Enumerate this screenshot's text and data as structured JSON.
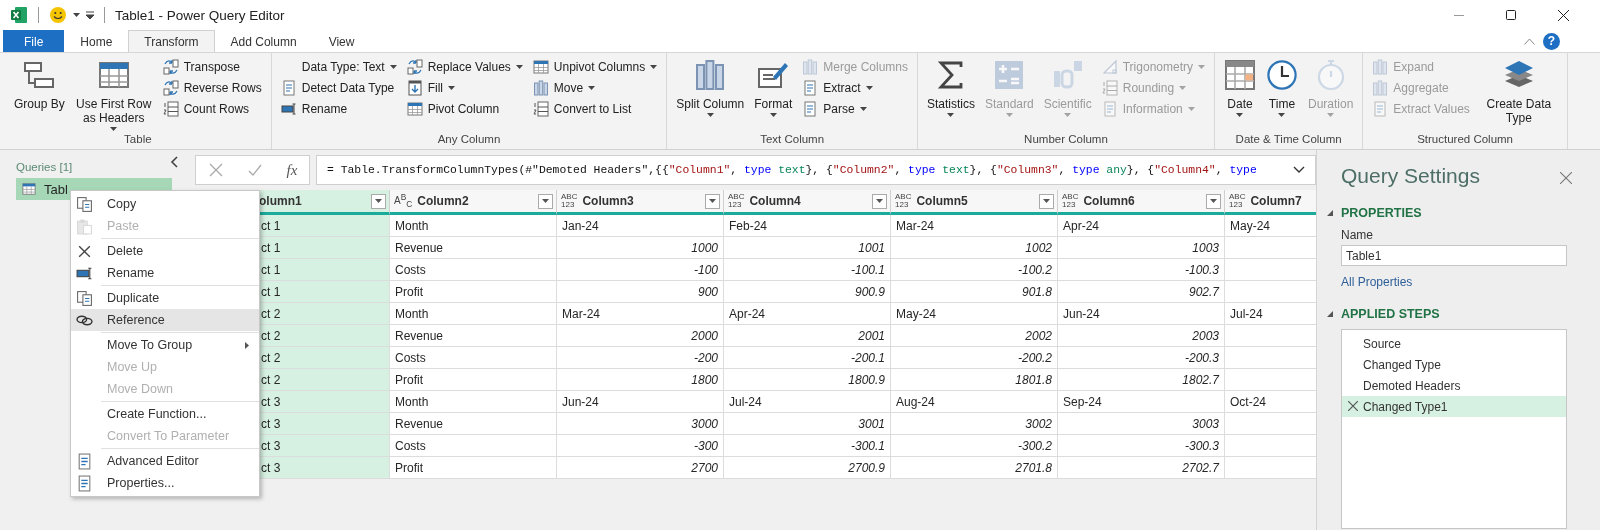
{
  "window": {
    "title": "Table1 - Power Query Editor"
  },
  "tabs": [
    {
      "label": "File",
      "kind": "file",
      "selected": false
    },
    {
      "label": "Home",
      "kind": "tab",
      "selected": false
    },
    {
      "label": "Transform",
      "kind": "tab",
      "selected": true
    },
    {
      "label": "Add Column",
      "kind": "tab",
      "selected": false
    },
    {
      "label": "View",
      "kind": "tab",
      "selected": false
    }
  ],
  "help": "?",
  "ribbon": {
    "groups": [
      {
        "label": "Table",
        "items": [
          {
            "kind": "large",
            "label": "Group By",
            "dropdown": false,
            "disabled": false
          },
          {
            "kind": "large",
            "label": "Use First Row as Headers",
            "dropdown": true,
            "disabled": false
          },
          {
            "kind": "stack",
            "items": [
              {
                "label": "Transpose",
                "dropdown": false,
                "disabled": false
              },
              {
                "label": "Reverse Rows",
                "dropdown": false,
                "disabled": false
              },
              {
                "label": "Count Rows",
                "dropdown": false,
                "disabled": false
              }
            ]
          }
        ]
      },
      {
        "label": "Any Column",
        "items": [
          {
            "kind": "stack",
            "items": [
              {
                "label": "Data Type: Text",
                "dropdown": true,
                "disabled": false
              },
              {
                "label": "Detect Data Type",
                "dropdown": false,
                "disabled": false
              },
              {
                "label": "Rename",
                "dropdown": false,
                "disabled": false
              }
            ]
          },
          {
            "kind": "stack",
            "items": [
              {
                "label": "Replace Values",
                "dropdown": true,
                "disabled": false
              },
              {
                "label": "Fill",
                "dropdown": true,
                "disabled": false
              },
              {
                "label": "Pivot Column",
                "dropdown": false,
                "disabled": false
              }
            ]
          },
          {
            "kind": "stack",
            "items": [
              {
                "label": "Unpivot Columns",
                "dropdown": true,
                "disabled": false
              },
              {
                "label": "Move",
                "dropdown": true,
                "disabled": false
              },
              {
                "label": "Convert to List",
                "dropdown": false,
                "disabled": false
              }
            ]
          }
        ]
      },
      {
        "label": "Text Column",
        "items": [
          {
            "kind": "large",
            "label": "Split Column",
            "dropdown": true,
            "disabled": false
          },
          {
            "kind": "large",
            "label": "Format",
            "dropdown": true,
            "disabled": false
          },
          {
            "kind": "stack",
            "items": [
              {
                "label": "Merge Columns",
                "dropdown": false,
                "disabled": true
              },
              {
                "label": "Extract",
                "dropdown": true,
                "disabled": false
              },
              {
                "label": "Parse",
                "dropdown": true,
                "disabled": false
              }
            ]
          }
        ]
      },
      {
        "label": "Number Column",
        "items": [
          {
            "kind": "large",
            "label": "Statistics",
            "dropdown": true,
            "disabled": false
          },
          {
            "kind": "large",
            "label": "Standard",
            "dropdown": true,
            "disabled": true
          },
          {
            "kind": "large",
            "label": "Scientific",
            "dropdown": true,
            "disabled": true
          },
          {
            "kind": "stack",
            "items": [
              {
                "label": "Trigonometry",
                "dropdown": true,
                "disabled": true
              },
              {
                "label": "Rounding",
                "dropdown": true,
                "disabled": true
              },
              {
                "label": "Information",
                "dropdown": true,
                "disabled": true
              }
            ]
          }
        ]
      },
      {
        "label": "Date & Time Column",
        "items": [
          {
            "kind": "large",
            "label": "Date",
            "dropdown": true,
            "disabled": false
          },
          {
            "kind": "large",
            "label": "Time",
            "dropdown": true,
            "disabled": false
          },
          {
            "kind": "large",
            "label": "Duration",
            "dropdown": true,
            "disabled": true
          }
        ]
      },
      {
        "label": "Structured Column",
        "items": [
          {
            "kind": "stack",
            "items": [
              {
                "label": "Expand",
                "dropdown": false,
                "disabled": true
              },
              {
                "label": "Aggregate",
                "dropdown": false,
                "disabled": true
              },
              {
                "label": "Extract Values",
                "dropdown": false,
                "disabled": true
              }
            ]
          },
          {
            "kind": "large",
            "label": "Create Data Type",
            "dropdown": false,
            "disabled": false
          }
        ]
      }
    ]
  },
  "queries": {
    "title": "Queries [1]",
    "items": [
      {
        "label": "Tabl",
        "selected": true
      }
    ]
  },
  "formula_bar": {
    "fx": "fx",
    "tokens": [
      {
        "kind": "plain",
        "text": "= Table.TransformColumnTypes(#\"Demoted Headers\",{{"
      },
      {
        "kind": "string",
        "text": "\"Column1\""
      },
      {
        "kind": "plain",
        "text": ", "
      },
      {
        "kind": "keyword",
        "text": "type"
      },
      {
        "kind": "type",
        "text": " text"
      },
      {
        "kind": "plain",
        "text": "}, {"
      },
      {
        "kind": "string",
        "text": "\"Column2\""
      },
      {
        "kind": "plain",
        "text": ", "
      },
      {
        "kind": "keyword",
        "text": "type"
      },
      {
        "kind": "type",
        "text": " text"
      },
      {
        "kind": "plain",
        "text": "}, {"
      },
      {
        "kind": "string",
        "text": "\"Column3\""
      },
      {
        "kind": "plain",
        "text": ", "
      },
      {
        "kind": "keyword",
        "text": "type"
      },
      {
        "kind": "type",
        "text": " any"
      },
      {
        "kind": "plain",
        "text": "}, {"
      },
      {
        "kind": "string",
        "text": "\"Column4\""
      },
      {
        "kind": "plain",
        "text": ", "
      },
      {
        "kind": "keyword",
        "text": "type"
      }
    ]
  },
  "table": {
    "columns": [
      {
        "name": "olumn1",
        "selected": true,
        "filter_button": true
      },
      {
        "name": "Column2",
        "type_icon": [
          "A$^{B}$$_{C}$"
        ],
        "selected": false,
        "filter_button": true
      },
      {
        "name": "Column3",
        "type_icon": [
          "ABC",
          "123"
        ],
        "selected": false,
        "filter_button": true
      },
      {
        "name": "Column4",
        "type_icon": [
          "ABC",
          "123"
        ],
        "selected": false,
        "filter_button": true
      },
      {
        "name": "Column5",
        "type_icon": [
          "ABC",
          "123"
        ],
        "selected": false,
        "filter_button": true
      },
      {
        "name": "Column6",
        "type_icon": [
          "ABC",
          "123"
        ],
        "selected": false,
        "filter_button": true
      },
      {
        "name": "Column7",
        "type_icon": [
          "ABC",
          "123"
        ],
        "selected": false
      }
    ],
    "rows": [
      {
        "kind": "text",
        "cells": [
          "ct 1",
          "Month",
          "Jan-24",
          "Feb-24",
          "Mar-24",
          "Apr-24",
          "May-24"
        ]
      },
      {
        "kind": "number",
        "cells": [
          "ct 1",
          "Revenue",
          "1000",
          "1001",
          "1002",
          "1003"
        ]
      },
      {
        "kind": "number",
        "cells": [
          "ct 1",
          "Costs",
          "-100",
          "-100.1",
          "-100.2",
          "-100.3"
        ]
      },
      {
        "kind": "number",
        "cells": [
          "ct 1",
          "Profit",
          "900",
          "900.9",
          "901.8",
          "902.7"
        ]
      },
      {
        "kind": "text",
        "cells": [
          "ct 2",
          "Month",
          "Mar-24",
          "Apr-24",
          "May-24",
          "Jun-24",
          "Jul-24"
        ]
      },
      {
        "kind": "number",
        "cells": [
          "ct 2",
          "Revenue",
          "2000",
          "2001",
          "2002",
          "2003"
        ]
      },
      {
        "kind": "number",
        "cells": [
          "ct 2",
          "Costs",
          "-200",
          "-200.1",
          "-200.2",
          "-200.3"
        ]
      },
      {
        "kind": "number",
        "cells": [
          "ct 2",
          "Profit",
          "1800",
          "1800.9",
          "1801.8",
          "1802.7"
        ]
      },
      {
        "kind": "text",
        "cells": [
          "ct 3",
          "Month",
          "Jun-24",
          "Jul-24",
          "Aug-24",
          "Sep-24",
          "Oct-24"
        ]
      },
      {
        "kind": "number",
        "cells": [
          "ct 3",
          "Revenue",
          "3000",
          "3001",
          "3002",
          "3003"
        ]
      },
      {
        "kind": "number",
        "cells": [
          "ct 3",
          "Costs",
          "-300",
          "-300.1",
          "-300.2",
          "-300.3"
        ]
      },
      {
        "kind": "number",
        "cells": [
          "ct 3",
          "Profit",
          "2700",
          "2700.9",
          "2701.8",
          "2702.7"
        ]
      }
    ]
  },
  "context_menu": {
    "groups": [
      [
        {
          "label": "Copy",
          "disabled": false,
          "selected": false,
          "submenu": false
        },
        {
          "label": "Paste",
          "disabled": true,
          "selected": false,
          "submenu": false
        }
      ],
      [
        {
          "label": "Delete",
          "disabled": false,
          "selected": false,
          "submenu": false
        },
        {
          "label": "Rename",
          "disabled": false,
          "selected": false,
          "submenu": false
        }
      ],
      [
        {
          "label": "Duplicate",
          "disabled": false,
          "selected": false,
          "submenu": false
        },
        {
          "label": "Reference",
          "disabled": false,
          "selected": true,
          "submenu": false
        }
      ],
      [
        {
          "label": "Move To Group",
          "disabled": false,
          "selected": false,
          "submenu": true
        },
        {
          "label": "Move Up",
          "disabled": true,
          "selected": false,
          "submenu": false
        },
        {
          "label": "Move Down",
          "disabled": true,
          "selected": false,
          "submenu": false
        }
      ],
      [
        {
          "label": "Create Function...",
          "disabled": false,
          "selected": false,
          "submenu": false
        },
        {
          "label": "Convert To Parameter",
          "disabled": true,
          "selected": false,
          "submenu": false
        }
      ],
      [
        {
          "label": "Advanced Editor",
          "disabled": false,
          "selected": false,
          "submenu": false
        },
        {
          "label": "Properties...",
          "disabled": false,
          "selected": false,
          "submenu": false
        }
      ]
    ]
  },
  "query_settings": {
    "title": "Query Settings",
    "properties": {
      "heading": "PROPERTIES",
      "name_label": "Name",
      "name_value": "Table1",
      "link": "All Properties"
    },
    "steps": {
      "heading": "APPLIED STEPS",
      "items": [
        {
          "label": "Source",
          "selected": false
        },
        {
          "label": "Changed Type",
          "selected": false
        },
        {
          "label": "Demoted Headers",
          "selected": false
        },
        {
          "label": "Changed Type1",
          "selected": true
        }
      ]
    }
  }
}
